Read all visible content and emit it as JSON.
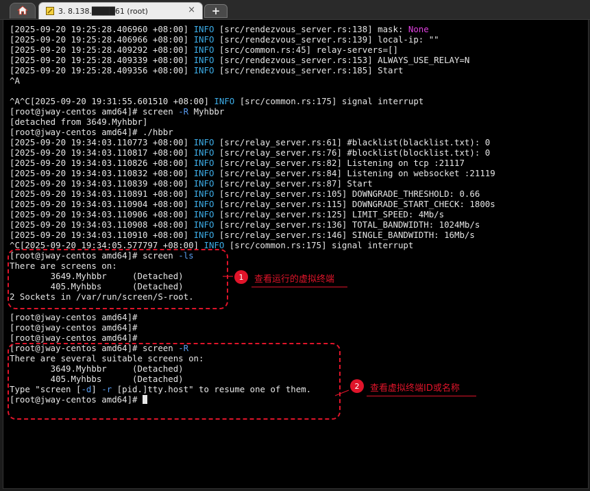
{
  "tabs": {
    "home_icon": "home-icon",
    "session_title": "3. 8.138.████61 (root)",
    "close_label": "×",
    "new_tab_label": "+"
  },
  "terminal": {
    "lines": [
      [
        {
          "t": "[2025-09-20 19:25:28.406960 +08:00] "
        },
        {
          "t": "INFO",
          "c": "info"
        },
        {
          "t": " [src/rendezvous_server.rs:138] mask: "
        },
        {
          "t": "None",
          "c": "none"
        }
      ],
      [
        {
          "t": "[2025-09-20 19:25:28.406966 +08:00] "
        },
        {
          "t": "INFO",
          "c": "info"
        },
        {
          "t": " [src/rendezvous_server.rs:139] local-ip: \"\""
        }
      ],
      [
        {
          "t": "[2025-09-20 19:25:28.409292 +08:00] "
        },
        {
          "t": "INFO",
          "c": "info"
        },
        {
          "t": " [src/common.rs:45] relay-servers=[]"
        }
      ],
      [
        {
          "t": "[2025-09-20 19:25:28.409339 +08:00] "
        },
        {
          "t": "INFO",
          "c": "info"
        },
        {
          "t": " [src/rendezvous_server.rs:153] ALWAYS_USE_RELAY=N"
        }
      ],
      [
        {
          "t": "[2025-09-20 19:25:28.409356 +08:00] "
        },
        {
          "t": "INFO",
          "c": "info"
        },
        {
          "t": " [src/rendezvous_server.rs:185] Start"
        }
      ],
      [
        {
          "t": "^A"
        }
      ],
      [
        {
          "t": ""
        }
      ],
      [
        {
          "t": "^A^C[2025-09-20 19:31:55.601510 +08:00] "
        },
        {
          "t": "INFO",
          "c": "info"
        },
        {
          "t": " [src/common.rs:175] signal interrupt"
        }
      ],
      [
        {
          "t": "[root@jway-centos amd64]# screen "
        },
        {
          "t": "-R",
          "c": "flag"
        },
        {
          "t": " Myhbbr"
        }
      ],
      [
        {
          "t": "[detached from 3649.Myhbbr]"
        }
      ],
      [
        {
          "t": "[root@jway-centos amd64]# ./hbbr"
        }
      ],
      [
        {
          "t": "[2025-09-20 19:34:03.110773 +08:00] "
        },
        {
          "t": "INFO",
          "c": "info"
        },
        {
          "t": " [src/relay_server.rs:61] #blacklist(blacklist.txt): 0"
        }
      ],
      [
        {
          "t": "[2025-09-20 19:34:03.110817 +08:00] "
        },
        {
          "t": "INFO",
          "c": "info"
        },
        {
          "t": " [src/relay_server.rs:76] #blocklist(blocklist.txt): 0"
        }
      ],
      [
        {
          "t": "[2025-09-20 19:34:03.110826 +08:00] "
        },
        {
          "t": "INFO",
          "c": "info"
        },
        {
          "t": " [src/relay_server.rs:82] Listening on tcp :21117"
        }
      ],
      [
        {
          "t": "[2025-09-20 19:34:03.110832 +08:00] "
        },
        {
          "t": "INFO",
          "c": "info"
        },
        {
          "t": " [src/relay_server.rs:84] Listening on websocket :21119"
        }
      ],
      [
        {
          "t": "[2025-09-20 19:34:03.110839 +08:00] "
        },
        {
          "t": "INFO",
          "c": "info"
        },
        {
          "t": " [src/relay_server.rs:87] Start"
        }
      ],
      [
        {
          "t": "[2025-09-20 19:34:03.110891 +08:00] "
        },
        {
          "t": "INFO",
          "c": "info"
        },
        {
          "t": " [src/relay_server.rs:105] DOWNGRADE_THRESHOLD: 0.66"
        }
      ],
      [
        {
          "t": "[2025-09-20 19:34:03.110904 +08:00] "
        },
        {
          "t": "INFO",
          "c": "info"
        },
        {
          "t": " [src/relay_server.rs:115] DOWNGRADE_START_CHECK: 1800s"
        }
      ],
      [
        {
          "t": "[2025-09-20 19:34:03.110906 +08:00] "
        },
        {
          "t": "INFO",
          "c": "info"
        },
        {
          "t": " [src/relay_server.rs:125] LIMIT_SPEED: 4Mb/s"
        }
      ],
      [
        {
          "t": "[2025-09-20 19:34:03.110908 +08:00] "
        },
        {
          "t": "INFO",
          "c": "info"
        },
        {
          "t": " [src/relay_server.rs:136] TOTAL_BANDWIDTH: 1024Mb/s"
        }
      ],
      [
        {
          "t": "[2025-09-20 19:34:03.110910 +08:00] "
        },
        {
          "t": "INFO",
          "c": "info"
        },
        {
          "t": " [src/relay_server.rs:146] SINGLE_BANDWIDTH: 16Mb/s"
        }
      ],
      [
        {
          "t": "^C[2025-09-20 19:34:05.577797 +08:00] "
        },
        {
          "t": "INFO",
          "c": "info"
        },
        {
          "t": " [src/common.rs:175] signal interrupt"
        }
      ],
      [
        {
          "t": "[root@jway-centos amd64]# screen "
        },
        {
          "t": "-ls",
          "c": "flag"
        }
      ],
      [
        {
          "t": "There are screens on:"
        }
      ],
      [
        {
          "t": "        3649.Myhbbr     (Detached)"
        }
      ],
      [
        {
          "t": "        405.Myhbbs      (Detached)"
        }
      ],
      [
        {
          "t": "2 Sockets in /var/run/screen/S-root."
        }
      ],
      [
        {
          "t": ""
        }
      ],
      [
        {
          "t": "[root@jway-centos amd64]#"
        }
      ],
      [
        {
          "t": "[root@jway-centos amd64]#"
        }
      ],
      [
        {
          "t": "[root@jway-centos amd64]#"
        }
      ],
      [
        {
          "t": "[root@jway-centos amd64]# screen "
        },
        {
          "t": "-R",
          "c": "flag"
        }
      ],
      [
        {
          "t": "There are several suitable screens on:"
        }
      ],
      [
        {
          "t": "        3649.Myhbbr     (Detached)"
        }
      ],
      [
        {
          "t": "        405.Myhbbs      (Detached)"
        }
      ],
      [
        {
          "t": "Type \"screen ["
        },
        {
          "t": "-d",
          "c": "flag"
        },
        {
          "t": "] "
        },
        {
          "t": "-r",
          "c": "flag"
        },
        {
          "t": " [pid.]tty.host\" to resume one of them."
        }
      ],
      [
        {
          "t": "[root@jway-centos amd64]# "
        },
        {
          "cursor": true
        }
      ]
    ]
  },
  "annotations": [
    {
      "number": "1",
      "text": "查看运行的虚拟终端"
    },
    {
      "number": "2",
      "text": "查看虚拟终端ID或名称"
    }
  ],
  "colors": {
    "info": "#3daee9",
    "none_keyword": "#e040e0",
    "flag": "#5a9df0",
    "annotation_red": "#e0142a"
  }
}
